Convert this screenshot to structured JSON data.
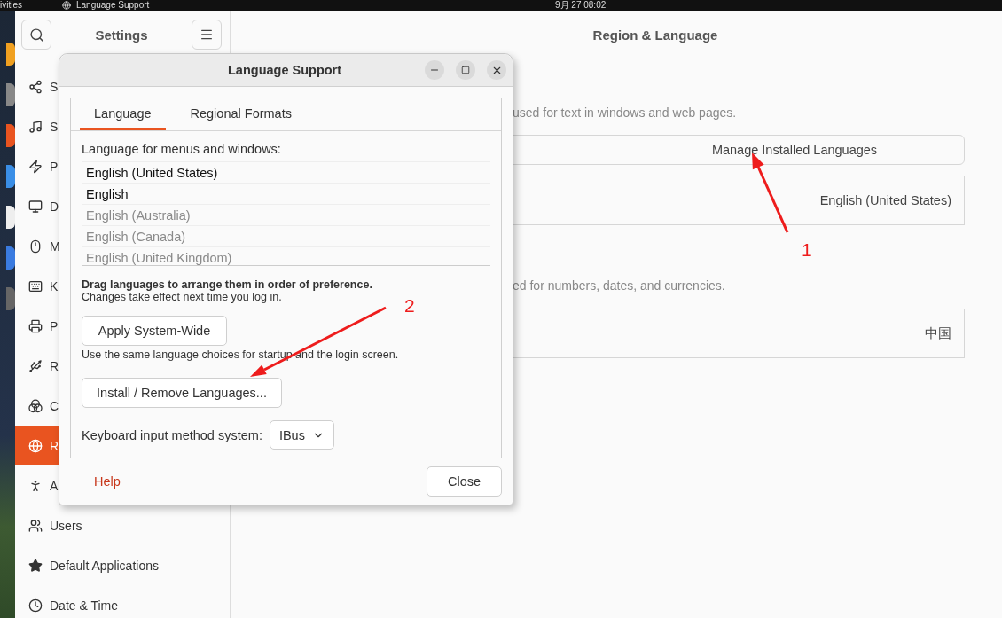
{
  "top_bar": {
    "activities": "ivities",
    "app_name": "Language Support",
    "clock": "9月 27  08:02"
  },
  "settings": {
    "title": "Settings",
    "items": [
      {
        "label": "S",
        "selected": false
      },
      {
        "label": "S",
        "selected": false
      },
      {
        "label": "P",
        "selected": false
      },
      {
        "label": "D",
        "selected": false
      },
      {
        "label": "M",
        "selected": false
      },
      {
        "label": "K",
        "selected": false
      },
      {
        "label": "P",
        "selected": false
      },
      {
        "label": "R",
        "selected": false
      },
      {
        "label": "C",
        "selected": false
      },
      {
        "label": "R",
        "selected": true
      },
      {
        "label": "A",
        "selected": false
      },
      {
        "label": "Users",
        "selected": false
      },
      {
        "label": "Default Applications",
        "selected": false
      },
      {
        "label": "Date & Time",
        "selected": false
      }
    ]
  },
  "panel": {
    "title": "Region & Language",
    "sections": [
      {
        "description": "used for text in windows and web pages.",
        "button": "Manage Installed Languages",
        "row_value": "English (United States)"
      },
      {
        "description": "ed for numbers, dates, and currencies.",
        "row_value": "中国"
      }
    ]
  },
  "dialog": {
    "title": "Language Support",
    "tabs": [
      {
        "label": "Language",
        "selected": true
      },
      {
        "label": "Regional Formats",
        "selected": false
      }
    ],
    "list_label": "Language for menus and windows:",
    "languages": [
      {
        "name": "English (United States)",
        "disabled": false
      },
      {
        "name": "English",
        "disabled": false
      },
      {
        "name": "English (Australia)",
        "disabled": true
      },
      {
        "name": "English (Canada)",
        "disabled": true
      },
      {
        "name": "English (United Kingdom)",
        "disabled": true
      }
    ],
    "hint_bold": "Drag languages to arrange them in order of preference.",
    "hint": "Changes take effect next time you log in.",
    "apply_button": "Apply System-Wide",
    "apply_note": "Use the same language choices for startup and the login screen.",
    "install_button": "Install / Remove Languages...",
    "input_method_label": "Keyboard input method system:",
    "input_method_value": "IBus",
    "help": "Help",
    "close": "Close"
  },
  "annotations": [
    {
      "number": "1"
    },
    {
      "number": "2"
    }
  ]
}
